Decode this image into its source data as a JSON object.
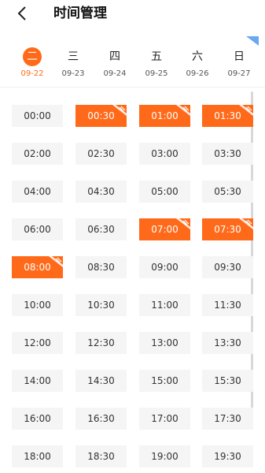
{
  "header": {
    "title": "时间管理"
  },
  "days": [
    {
      "weekday": "二",
      "date": "09-22",
      "active": true
    },
    {
      "weekday": "三",
      "date": "09-23",
      "active": false
    },
    {
      "weekday": "四",
      "date": "09-24",
      "active": false
    },
    {
      "weekday": "五",
      "date": "09-25",
      "active": false
    },
    {
      "weekday": "六",
      "date": "09-26",
      "active": false
    },
    {
      "weekday": "日",
      "date": "09-27",
      "active": false
    }
  ],
  "colors": {
    "accent": "#ff6a1a",
    "slot_bg": "#f5f5f5",
    "text": "#333333"
  },
  "slots": [
    {
      "time": "00:00",
      "selected": false
    },
    {
      "time": "00:30",
      "selected": true
    },
    {
      "time": "01:00",
      "selected": true
    },
    {
      "time": "01:30",
      "selected": true
    },
    {
      "time": "02:00",
      "selected": false
    },
    {
      "time": "02:30",
      "selected": false
    },
    {
      "time": "03:00",
      "selected": false
    },
    {
      "time": "03:30",
      "selected": false
    },
    {
      "time": "04:00",
      "selected": false
    },
    {
      "time": "04:30",
      "selected": false
    },
    {
      "time": "05:00",
      "selected": false
    },
    {
      "time": "05:30",
      "selected": false
    },
    {
      "time": "06:00",
      "selected": false
    },
    {
      "time": "06:30",
      "selected": false
    },
    {
      "time": "07:00",
      "selected": true
    },
    {
      "time": "07:30",
      "selected": true
    },
    {
      "time": "08:00",
      "selected": true
    },
    {
      "time": "08:30",
      "selected": false
    },
    {
      "time": "09:00",
      "selected": false
    },
    {
      "time": "09:30",
      "selected": false
    },
    {
      "time": "10:00",
      "selected": false
    },
    {
      "time": "10:30",
      "selected": false
    },
    {
      "time": "11:00",
      "selected": false
    },
    {
      "time": "11:30",
      "selected": false
    },
    {
      "time": "12:00",
      "selected": false
    },
    {
      "time": "12:30",
      "selected": false
    },
    {
      "time": "13:00",
      "selected": false
    },
    {
      "time": "13:30",
      "selected": false
    },
    {
      "time": "14:00",
      "selected": false
    },
    {
      "time": "14:30",
      "selected": false
    },
    {
      "time": "15:00",
      "selected": false
    },
    {
      "time": "15:30",
      "selected": false
    },
    {
      "time": "16:00",
      "selected": false
    },
    {
      "time": "16:30",
      "selected": false
    },
    {
      "time": "17:00",
      "selected": false
    },
    {
      "time": "17:30",
      "selected": false
    },
    {
      "time": "18:00",
      "selected": false
    },
    {
      "time": "18:30",
      "selected": false
    },
    {
      "time": "19:00",
      "selected": false
    },
    {
      "time": "19:30",
      "selected": false
    }
  ]
}
